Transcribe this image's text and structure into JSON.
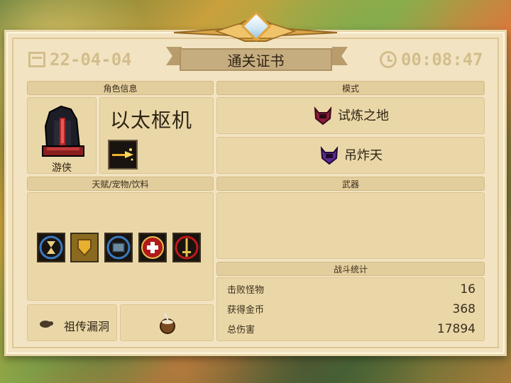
{
  "header": {
    "title": "通关证书",
    "date": "22-04-04",
    "time": "00:08:47"
  },
  "character": {
    "section_label": "角色信息",
    "name": "以太枢机",
    "class_label": "游侠"
  },
  "mode": {
    "section_label": "模式",
    "items": [
      {
        "label": "试炼之地",
        "icon": "crimson-demon-helmet-icon"
      },
      {
        "label": "吊炸天",
        "icon": "purple-demon-helmet-icon"
      }
    ]
  },
  "talents": {
    "section_label": "天赋/宠物/饮料",
    "icons": [
      "hourglass-talent-icon",
      "shield-talent-icon",
      "chest-talent-icon",
      "heal-talent-icon",
      "sword-talent-icon"
    ],
    "pet_label": "祖传漏洞",
    "pet_icon": "turtle-pet-icon",
    "drink_icon": "coconut-drink-icon"
  },
  "weapons": {
    "section_label": "武器"
  },
  "battle_stats": {
    "section_label": "战斗统计",
    "rows": [
      {
        "label": "击败怪物",
        "value": "16"
      },
      {
        "label": "获得金币",
        "value": "368"
      },
      {
        "label": "总伤害",
        "value": "17894"
      }
    ]
  },
  "colors": {
    "card_bg": "#f2e4c2",
    "panel_bg": "#ead7a8",
    "header_bg": "#e2cd9d",
    "ribbon_bg": "#c6ad80",
    "text": "#2e2414"
  }
}
